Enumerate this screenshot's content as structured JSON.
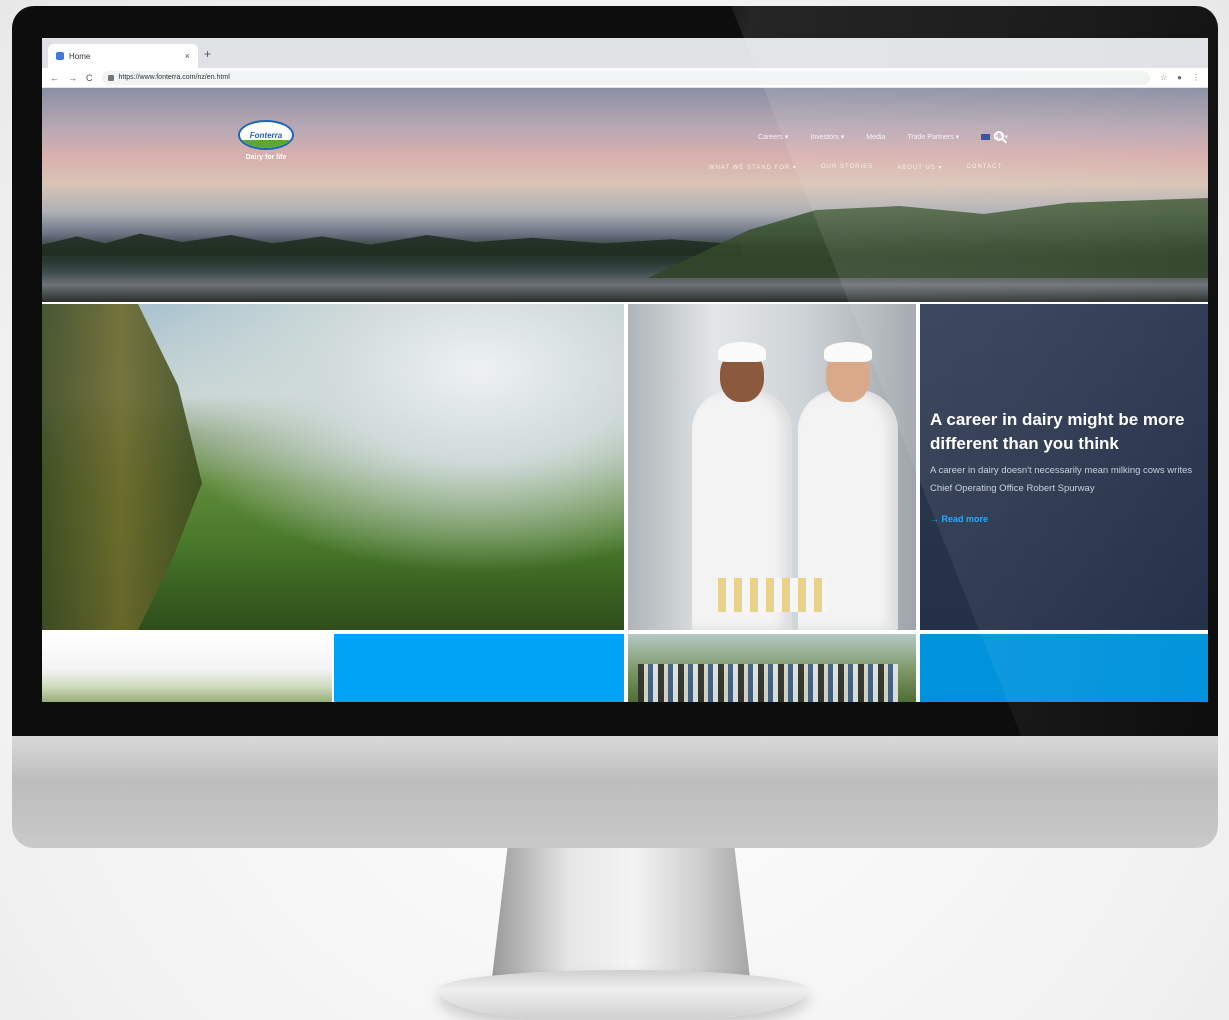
{
  "browser": {
    "tab_title": "Home",
    "tab_close": "×",
    "new_tab": "+",
    "url": "https://www.fonterra.com/nz/en.html",
    "back": "←",
    "forward": "→",
    "reload": "C",
    "toolbar_icons": [
      "☆",
      "●",
      "⋮"
    ]
  },
  "site": {
    "logo_text": "Fonterra",
    "logo_tagline": "Dairy for life",
    "nav_top": [
      "Careers ▾",
      "Investors ▾",
      "Media",
      "Trade Partners ▾",
      "NZ ▾"
    ],
    "nav_main": [
      "WHAT WE STAND FOR ▾",
      "OUR STORIES",
      "ABOUT US ▾",
      "CONTACT"
    ]
  },
  "article": {
    "title": "A career in dairy might be more different than you think",
    "body": "A career in dairy doesn't necessarily mean milking cows writes Chief Operating Office Robert Spurway",
    "link": "→  Read more"
  },
  "colors": {
    "article_bg": "#243047",
    "accent_blue": "#00a3f5",
    "link": "#1aa3ff"
  }
}
